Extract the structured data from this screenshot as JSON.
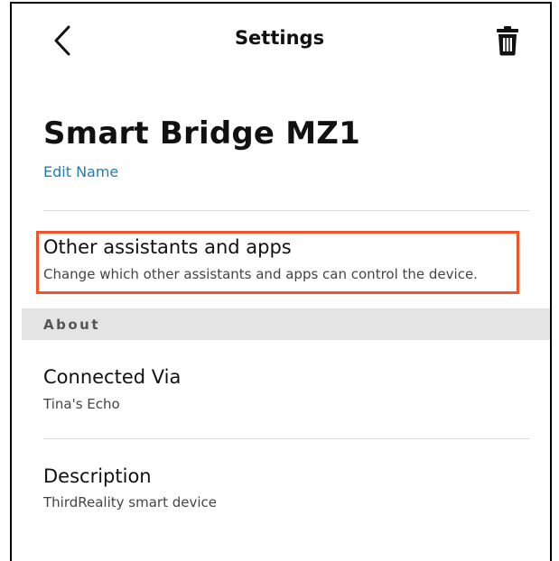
{
  "header": {
    "title": "Settings",
    "back_icon": "chevron-left-icon",
    "delete_icon": "trash-icon"
  },
  "device": {
    "name": "Smart Bridge MZ1",
    "edit_label": "Edit Name"
  },
  "other_assistants": {
    "title": "Other assistants and apps",
    "subtitle": "Change which other assistants and apps can control the device."
  },
  "about": {
    "section_label": "About",
    "connected_via": {
      "title": "Connected Via",
      "value": "Tina's Echo"
    },
    "description": {
      "title": "Description",
      "value": "ThirdReality smart device"
    }
  },
  "colors": {
    "link": "#1e7fb2",
    "highlight": "#f0552a",
    "section_bg": "#e4e4e4"
  }
}
